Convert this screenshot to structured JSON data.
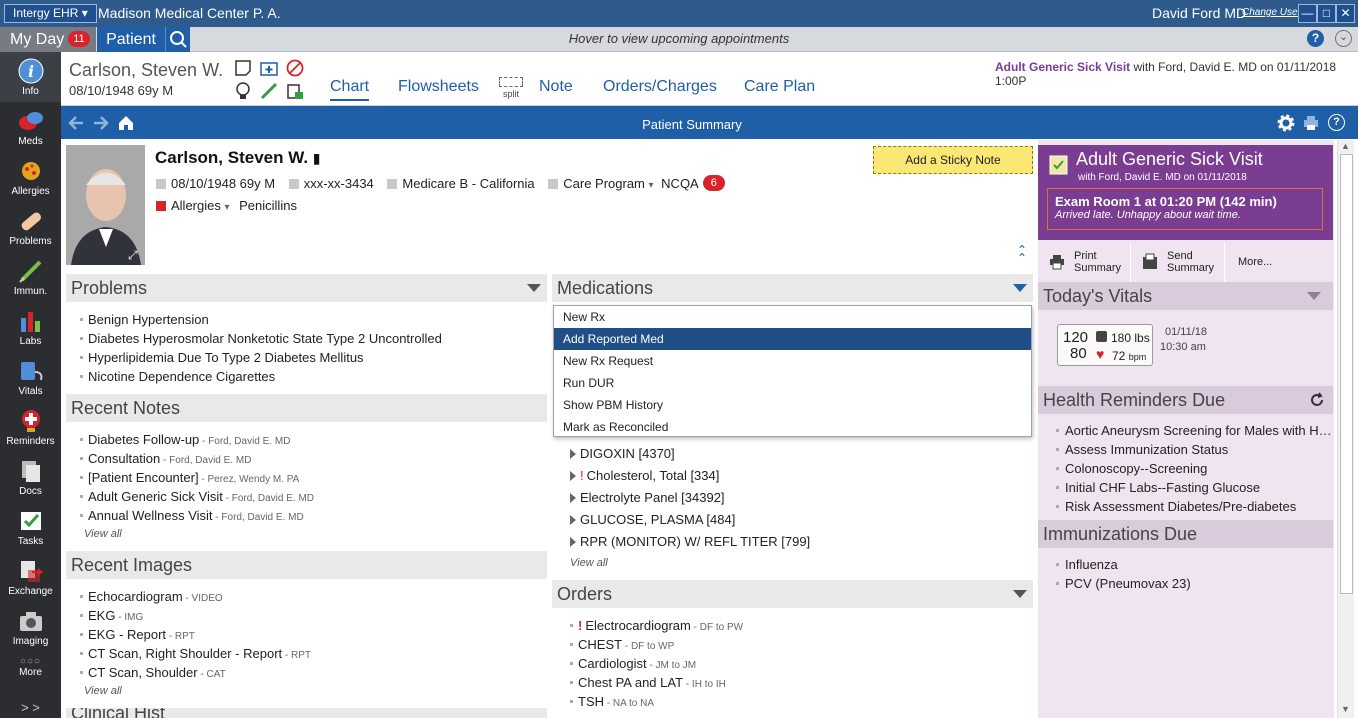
{
  "titlebar": {
    "app_name": "Intergy EHR",
    "center_name": "Madison Medical Center P. A.",
    "user_name": "David Ford MD",
    "change_user": "Change User"
  },
  "tabs": {
    "myday_label": "My Day",
    "myday_count": "11",
    "patient_label": "Patient",
    "hover_text": "Hover to view upcoming appointments"
  },
  "sidebar": {
    "items": [
      {
        "label": "Info",
        "icon": "info-icon"
      },
      {
        "label": "Meds",
        "icon": "pills-icon"
      },
      {
        "label": "Allergies",
        "icon": "allergy-icon"
      },
      {
        "label": "Problems",
        "icon": "bandage-icon"
      },
      {
        "label": "Immun.",
        "icon": "syringe-icon"
      },
      {
        "label": "Labs",
        "icon": "bar-chart-icon"
      },
      {
        "label": "Vitals",
        "icon": "stethoscope-icon"
      },
      {
        "label": "Reminders",
        "icon": "reminder-icon"
      },
      {
        "label": "Docs",
        "icon": "documents-icon"
      },
      {
        "label": "Tasks",
        "icon": "check-icon"
      },
      {
        "label": "Exchange",
        "icon": "exchange-icon"
      },
      {
        "label": "Imaging",
        "icon": "camera-icon"
      },
      {
        "label": "More",
        "icon": "more-dots-icon"
      }
    ],
    "expand": "> >"
  },
  "header": {
    "patient_name": "Carlson, Steven W.",
    "dob_age": "08/10/1948  69y M",
    "split_label": "split",
    "nav": {
      "chart": "Chart",
      "flowsheets": "Flowsheets",
      "note": "Note",
      "orders": "Orders/Charges",
      "careplan": "Care Plan"
    },
    "visit_title": "Adult Generic Sick Visit",
    "visit_rest": " with Ford, David E. MD  on 01/11/2018 1:00P"
  },
  "bluebar": {
    "title": "Patient Summary"
  },
  "patient": {
    "name": "Carlson, Steven W.",
    "dob": "08/10/1948  69y M",
    "ssn": "xxx-xx-3434",
    "insurance": "Medicare B - California",
    "care_program": "Care Program",
    "ncqa": "NCQA",
    "ncqa_count": "6",
    "allergies_label": "Allergies",
    "allergies_value": "Penicillins",
    "sticky_label": "Add a Sticky Note"
  },
  "problems": {
    "title": "Problems",
    "items": [
      "Benign Hypertension",
      "Diabetes Hyperosmolar Nonketotic State Type 2 Uncontrolled",
      "Hyperlipidemia Due To Type 2 Diabetes Mellitus",
      "Nicotine Dependence Cigarettes"
    ]
  },
  "recent_notes": {
    "title": "Recent Notes",
    "items": [
      {
        "name": "Diabetes Follow-up",
        "by": " - Ford, David E. MD"
      },
      {
        "name": "Consultation",
        "by": " - Ford, David E. MD"
      },
      {
        "name": "[Patient Encounter]",
        "by": " - Perez, Wendy M. PA"
      },
      {
        "name": "Adult Generic Sick Visit",
        "by": " - Ford, David E. MD"
      },
      {
        "name": "Annual Wellness Visit",
        "by": " - Ford, David E. MD"
      }
    ],
    "view_all": "View all"
  },
  "recent_images": {
    "title": "Recent Images",
    "items": [
      {
        "name": "Echocardiogram",
        "type": " - VIDEO"
      },
      {
        "name": "EKG",
        "type": " - IMG"
      },
      {
        "name": "EKG - Report",
        "type": " - RPT"
      },
      {
        "name": "CT Scan, Right Shoulder - Report",
        "type": " - RPT"
      },
      {
        "name": "CT Scan, Shoulder",
        "type": " - CAT"
      }
    ],
    "view_all": "View all"
  },
  "clinical_title": "Clinical Hist",
  "medications": {
    "title": "Medications",
    "menu": [
      "New Rx",
      "Add Reported Med",
      "New Rx Request",
      "Run DUR",
      "Show PBM History",
      "Mark as Reconciled"
    ],
    "selected_index": 1
  },
  "labs": {
    "items": [
      "DIGOXIN [4370]",
      "Cholesterol, Total [334]",
      "Electrolyte Panel [34392]",
      "GLUCOSE, PLASMA [484]",
      "RPR (MONITOR) W/ REFL TITER [799]"
    ],
    "alert_mark": "!",
    "view_all": "View all"
  },
  "orders": {
    "title": "Orders",
    "items": [
      {
        "name": "Electrocardiogram",
        "route": " - DF to PW",
        "alert": "!"
      },
      {
        "name": "CHEST",
        "route": " - DF to WP",
        "alert": ""
      },
      {
        "name": "Cardiologist",
        "route": " - JM to JM",
        "alert": ""
      },
      {
        "name": "Chest PA and LAT",
        "route": " - IH to IH",
        "alert": ""
      },
      {
        "name": "TSH",
        "route": " - NA to NA",
        "alert": ""
      }
    ]
  },
  "visit_panel": {
    "title": "Adult Generic Sick Visit",
    "subtitle": "with Ford, David E. MD on 01/11/2018",
    "room": "Exam Room 1 at 01:20 PM  (142 min)",
    "note": "Arrived late. Unhappy about wait time.",
    "print_1": "Print",
    "print_2": "Summary",
    "send_1": "Send",
    "send_2": "Summary",
    "more": "More..."
  },
  "vitals": {
    "title": "Today's Vitals",
    "systolic": "120",
    "diastolic": "80",
    "weight": "180",
    "weight_unit": "lbs",
    "pulse": "72",
    "pulse_unit": "bpm",
    "date": "01/11/18",
    "time": "10:30 am"
  },
  "health_reminders": {
    "title": "Health Reminders Due",
    "items": [
      "Aortic Aneurysm Screening for Males with History of Smoking",
      "Assess Immunization Status",
      "Colonoscopy--Screening",
      "Initial CHF Labs--Fasting Glucose",
      "Risk Assessment Diabetes/Pre-diabetes"
    ]
  },
  "immunizations": {
    "title": "Immunizations Due",
    "items": [
      "Influenza",
      "PCV (Pneumovax 23)"
    ]
  },
  "colors": {
    "brand_blue": "#1f5fa8",
    "visit_purple": "#7a3d92",
    "alert_red": "#d8232a",
    "sticky_yellow": "#fbe874"
  }
}
